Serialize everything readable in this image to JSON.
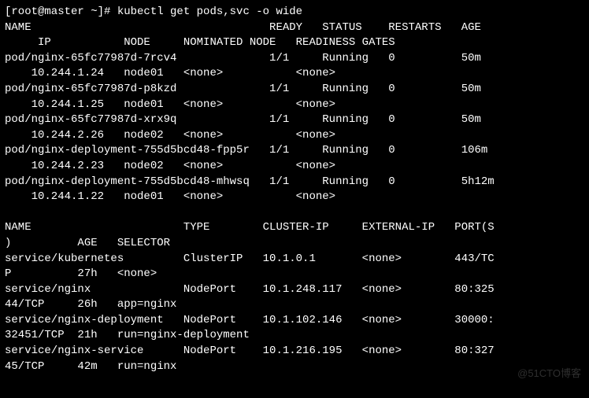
{
  "prompt": "[root@master ~]# kubectl get pods,svc -o wide",
  "pod_headers_1": "NAME                                    READY   STATUS    RESTARTS   AGE",
  "pod_headers_2": "     IP           NODE     NOMINATED NODE   READINESS GATES",
  "pods": [
    {
      "l1": "pod/nginx-65fc77987d-7rcv4              1/1     Running   0          50m",
      "l2": "    10.244.1.24   node01   <none>           <none>"
    },
    {
      "l1": "pod/nginx-65fc77987d-p8kzd              1/1     Running   0          50m",
      "l2": "    10.244.1.25   node01   <none>           <none>"
    },
    {
      "l1": "pod/nginx-65fc77987d-xrx9q              1/1     Running   0          50m",
      "l2": "    10.244.2.26   node02   <none>           <none>"
    },
    {
      "l1": "pod/nginx-deployment-755d5bcd48-fpp5r   1/1     Running   0          106m",
      "l2": "    10.244.2.23   node02   <none>           <none>"
    },
    {
      "l1": "pod/nginx-deployment-755d5bcd48-mhwsq   1/1     Running   0          5h12m",
      "l2": "    10.244.1.22   node01   <none>           <none>"
    }
  ],
  "blank": "",
  "svc_headers_1": "NAME                       TYPE        CLUSTER-IP     EXTERNAL-IP   PORT(S",
  "svc_headers_2": ")          AGE   SELECTOR",
  "services": [
    {
      "l1": "service/kubernetes         ClusterIP   10.1.0.1       <none>        443/TC",
      "l2": "P          27h   <none>"
    },
    {
      "l1": "service/nginx              NodePort    10.1.248.117   <none>        80:325",
      "l2": "44/TCP     26h   app=nginx"
    },
    {
      "l1": "service/nginx-deployment   NodePort    10.1.102.146   <none>        30000:",
      "l2": "32451/TCP  21h   run=nginx-deployment"
    },
    {
      "l1": "service/nginx-service      NodePort    10.1.216.195   <none>        80:327",
      "l2": "45/TCP     42m   run=nginx"
    }
  ],
  "watermark": "@51CTO博客"
}
